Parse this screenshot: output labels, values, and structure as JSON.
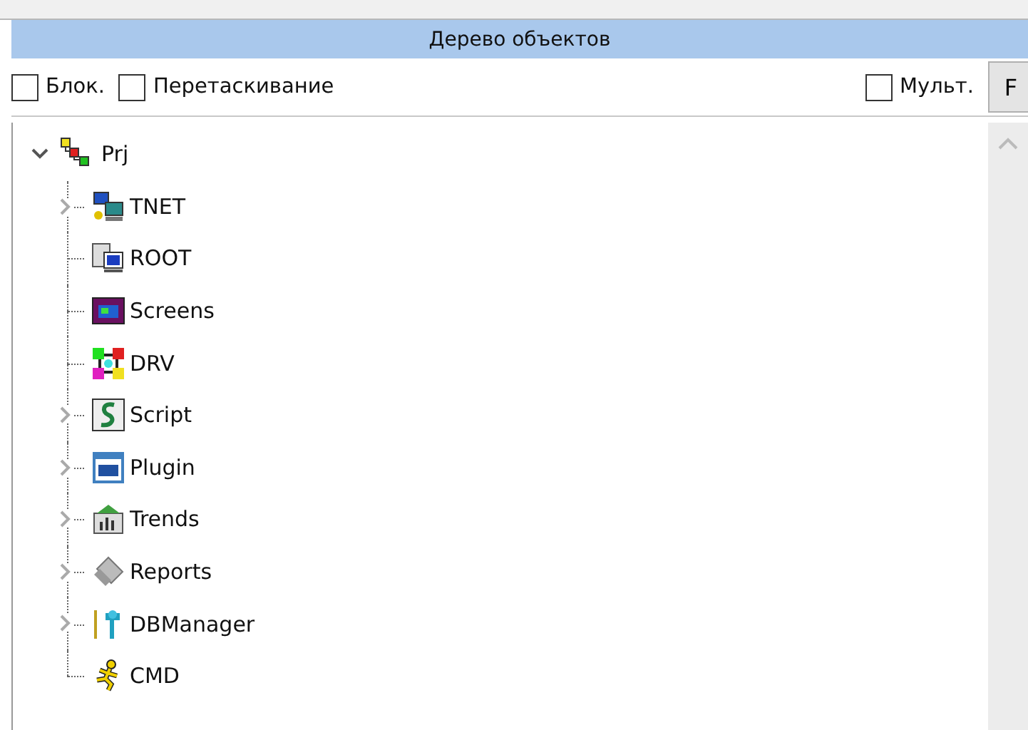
{
  "panel": {
    "title": "Дерево объектов"
  },
  "options": [
    {
      "label": "Блок.",
      "checked": false
    },
    {
      "label": "Перетаскивание",
      "checked": false
    }
  ],
  "right_option": {
    "label": "Мульт.",
    "checked": false
  },
  "filter_button": "F",
  "tree": {
    "label": "Prj",
    "expanded": true,
    "children": [
      {
        "label": "TNET",
        "expandable": true
      },
      {
        "label": "ROOT",
        "expandable": false
      },
      {
        "label": "Screens",
        "expandable": false
      },
      {
        "label": "DRV",
        "expandable": false
      },
      {
        "label": "Script",
        "expandable": true
      },
      {
        "label": "Plugin",
        "expandable": true
      },
      {
        "label": "Trends",
        "expandable": true
      },
      {
        "label": "Reports",
        "expandable": true
      },
      {
        "label": "DBManager",
        "expandable": true
      },
      {
        "label": "CMD",
        "expandable": false
      }
    ]
  }
}
